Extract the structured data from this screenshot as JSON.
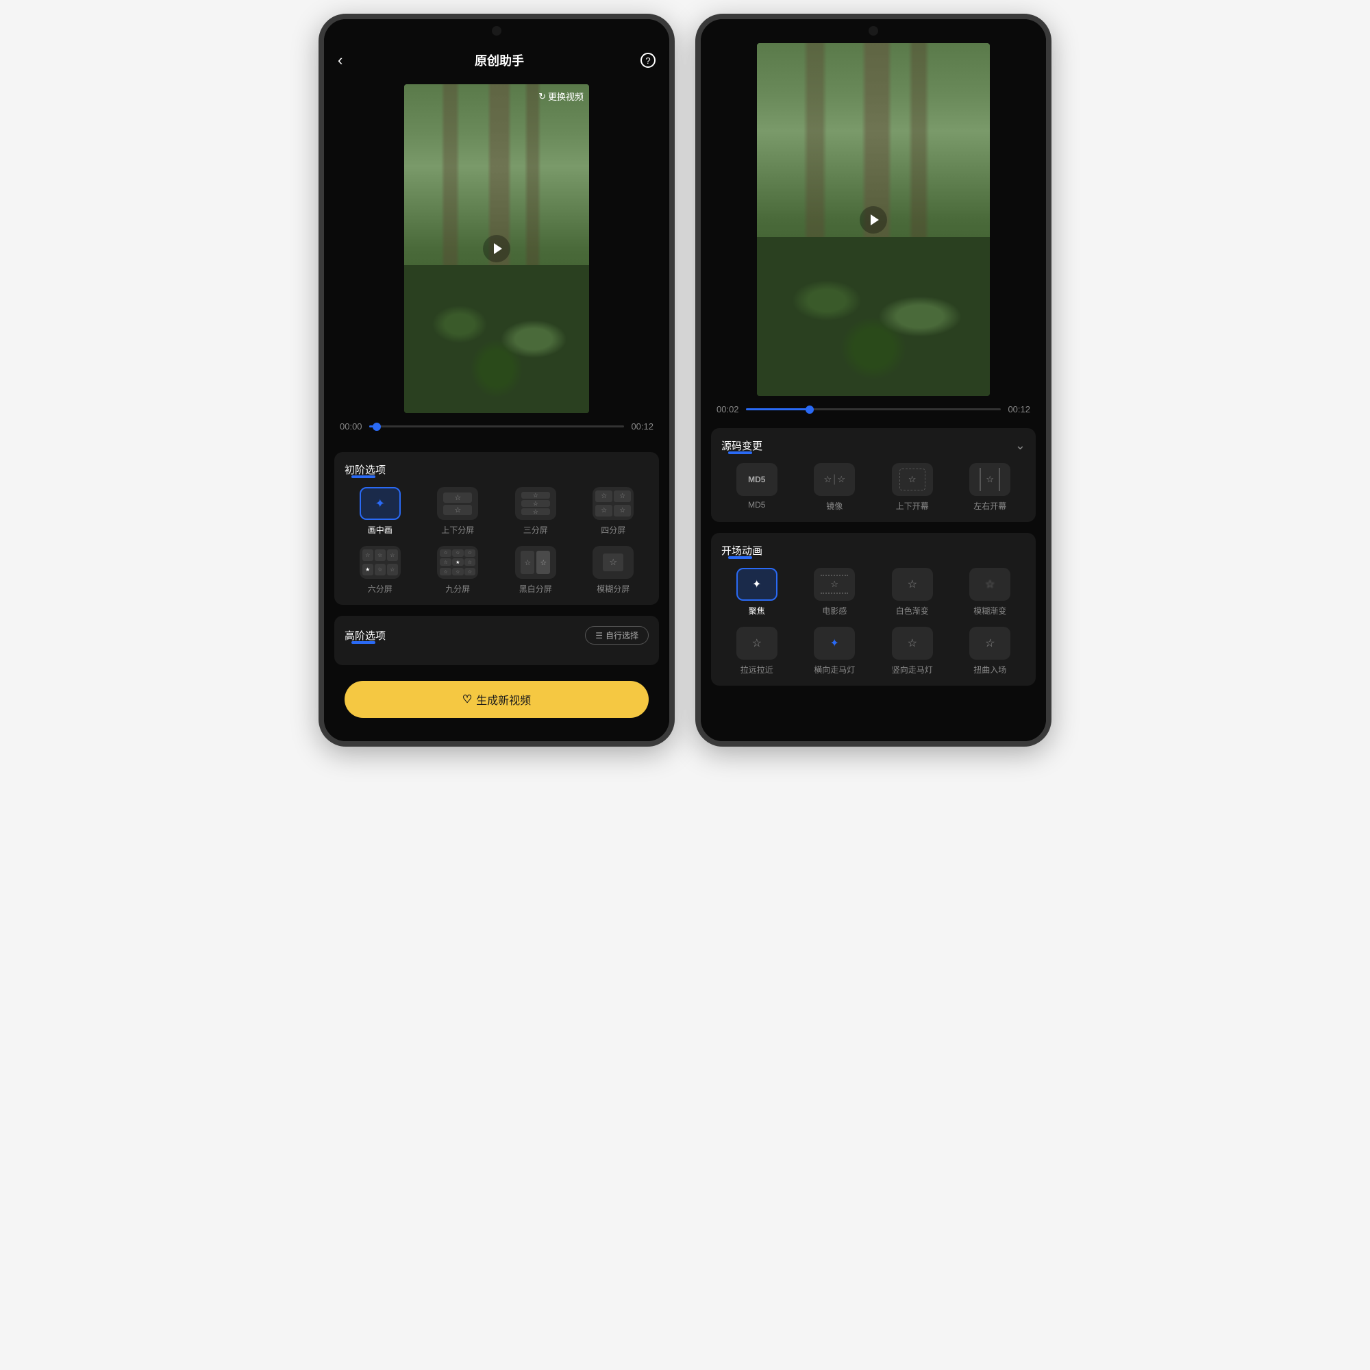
{
  "phone1": {
    "header": {
      "title": "原创助手"
    },
    "video": {
      "replaceLabel": "更换视频",
      "timeStart": "00:00",
      "timeEnd": "00:12",
      "progress": 3
    },
    "basicSection": {
      "title": "初阶选项",
      "options": [
        {
          "label": "画中画",
          "active": true
        },
        {
          "label": "上下分屏",
          "active": false
        },
        {
          "label": "三分屏",
          "active": false
        },
        {
          "label": "四分屏",
          "active": false
        },
        {
          "label": "六分屏",
          "active": false
        },
        {
          "label": "九分屏",
          "active": false
        },
        {
          "label": "黑白分屏",
          "active": false
        },
        {
          "label": "模糊分屏",
          "active": false
        }
      ]
    },
    "advancedSection": {
      "title": "高阶选项",
      "customLabel": "自行选择"
    },
    "generateBtn": "生成新视频"
  },
  "phone2": {
    "video": {
      "timeStart": "00:02",
      "timeEnd": "00:12",
      "progress": 25
    },
    "sourceSection": {
      "title": "源码变更",
      "options": [
        {
          "label": "MD5",
          "iconText": "MD5"
        },
        {
          "label": "镜像"
        },
        {
          "label": "上下开幕"
        },
        {
          "label": "左右开幕"
        }
      ]
    },
    "animSection": {
      "title": "开场动画",
      "options": [
        {
          "label": "聚焦",
          "active": true
        },
        {
          "label": "电影感",
          "active": false
        },
        {
          "label": "白色渐变",
          "active": false
        },
        {
          "label": "模糊渐变",
          "active": false
        },
        {
          "label": "拉远拉近",
          "active": false
        },
        {
          "label": "横向走马灯",
          "active": false
        },
        {
          "label": "竖向走马灯",
          "active": false
        },
        {
          "label": "扭曲入场",
          "active": false
        }
      ]
    }
  }
}
